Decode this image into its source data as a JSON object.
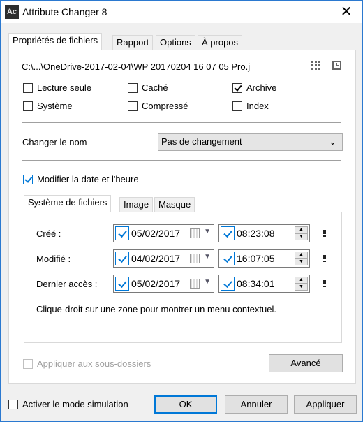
{
  "window": {
    "title": "Attribute Changer 8",
    "logo": "Ac",
    "close": "✕"
  },
  "tabs": [
    "Propriétés de fichiers",
    "Rapport",
    "Options",
    "À propos"
  ],
  "path": "C:\\...\\OneDrive-2017-02-04\\WP  20170204  16  07  05  Pro.j",
  "attributes": [
    {
      "label": "Lecture seule",
      "checked": false
    },
    {
      "label": "Caché",
      "checked": false
    },
    {
      "label": "Archive",
      "checked": true
    },
    {
      "label": "Système",
      "checked": false
    },
    {
      "label": "Compressé",
      "checked": false
    },
    {
      "label": "Index",
      "checked": false
    }
  ],
  "rename": {
    "label": "Changer le nom",
    "value": "Pas de changement"
  },
  "datetime": {
    "label": "Modifier la date et l'heure",
    "checked": true
  },
  "subtabs": [
    "Système de fichiers",
    "Image",
    "Masque"
  ],
  "rows": [
    {
      "label": "Créé :",
      "date": "05/02/2017",
      "time": "08:23:08"
    },
    {
      "label": "Modifié :",
      "date": "04/02/2017",
      "time": "16:07:05"
    },
    {
      "label": "Dernier accès :",
      "date": "05/02/2017",
      "time": "08:34:01"
    }
  ],
  "hint": "Clique-droit sur une zone pour montrer un menu contextuel.",
  "subfolders": "Appliquer aux sous-dossiers",
  "advanced": "Avancé",
  "simulation": "Activer le mode simulation",
  "buttons": {
    "ok": "OK",
    "cancel": "Annuler",
    "apply": "Appliquer"
  },
  "colors": {
    "accent": "#0078d7",
    "border": "#2b79d0"
  }
}
